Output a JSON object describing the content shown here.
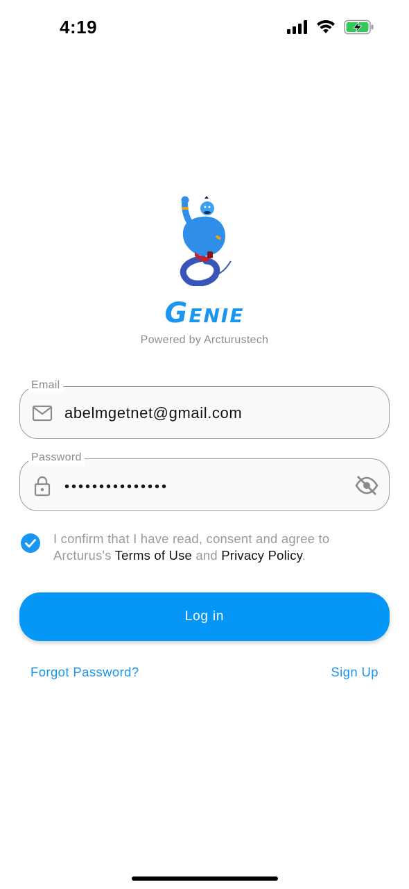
{
  "status_bar": {
    "time": "4:19",
    "icons": [
      "cellular-signal-icon",
      "wifi-icon",
      "battery-charging-icon"
    ]
  },
  "app": {
    "title": "Genie",
    "subtitle": "Powered by Arcturustech",
    "logo": "genie-mascot-logo"
  },
  "form": {
    "email": {
      "label": "Email",
      "value": "abelmgetnet@gmail.com",
      "icon": "mail-icon"
    },
    "password": {
      "label": "Password",
      "masked_value": "•••••••••••••••",
      "icon": "lock-icon",
      "toggle_icon": "eye-off-icon"
    },
    "consent": {
      "checked": true,
      "text_before": "I confirm that I have read, consent and agree to Arcturus's ",
      "terms_link": "Terms of Use",
      "text_middle": " and ",
      "privacy_link": "Privacy Policy",
      "text_after": "."
    },
    "login_label": "Log in",
    "forgot_password_label": "Forgot Password?",
    "sign_up_label": "Sign Up"
  },
  "colors": {
    "accent": "#0597f6",
    "link": "#1a96f0",
    "muted_text": "#9a9a9a",
    "field_border": "#9a9a9a"
  }
}
